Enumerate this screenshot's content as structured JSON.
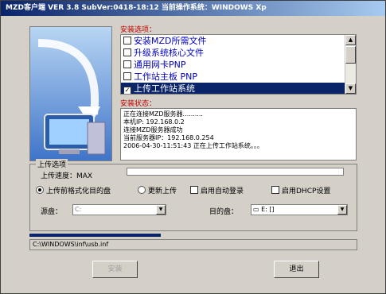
{
  "window": {
    "title": "MZD客户端 VER 3.8  SubVer:0418-18:12  当前操作系统：WINDOWS Xp"
  },
  "install_options": {
    "label": "安装选项：",
    "items": [
      {
        "label": "安装MZD所需文件",
        "checked": false,
        "selected": false
      },
      {
        "label": "升级系统核心文件",
        "checked": false,
        "selected": false
      },
      {
        "label": "通用网卡PNP",
        "checked": false,
        "selected": false
      },
      {
        "label": "工作站主板 PNP",
        "checked": false,
        "selected": false
      },
      {
        "label": "上传工作站系统",
        "checked": true,
        "selected": true
      }
    ]
  },
  "install_status": {
    "label": "安装状态：",
    "lines": [
      "正在连接MZD服务器..........",
      "本机IP: 192.168.0.2",
      "连接MZD服务器成功",
      "当前服务器IP：192.168.0.254",
      "2006-04-30-11:51:43 正在上传工作站系统。。。"
    ]
  },
  "upload_options": {
    "legend": "上传选项",
    "speed_label": "上传速度：MAX",
    "speed_progress": 0,
    "radio_format": "上传前格式化目的盘",
    "radio_format_on": true,
    "radio_update": "更新上传",
    "radio_update_on": false,
    "check_autologin": "启用自动登录",
    "check_dhcp": "启用DHCP设置",
    "source_label": "源盘：",
    "source_value": "C:",
    "target_label": "目的盘：",
    "target_value": "E: []"
  },
  "overall_progress": 0.4,
  "path": "C:\\WINDOWS\\inf\\usb.inf",
  "buttons": {
    "install": "安装",
    "exit": "退出"
  }
}
